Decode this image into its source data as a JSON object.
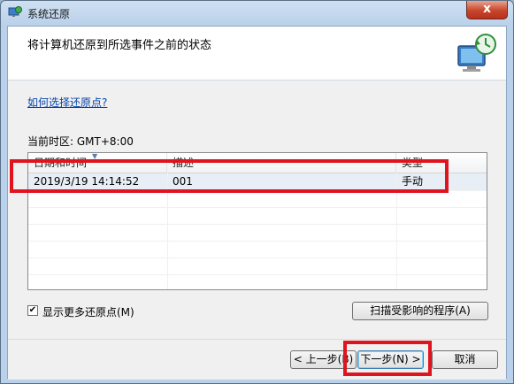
{
  "window": {
    "title": "系统还原",
    "close_symbol": "x"
  },
  "header": {
    "title": "将计算机还原到所选事件之前的状态",
    "graphic_icon": "system-restore-icon"
  },
  "main": {
    "help_link": "如何选择还原点?",
    "timezone": "当前时区: GMT+8:00",
    "table": {
      "columns": [
        "日期和时间",
        "描述",
        "类型"
      ],
      "rows": [
        {
          "datetime": "2019/3/19 14:14:52",
          "description": "001",
          "type": "手动"
        }
      ]
    },
    "show_more": {
      "label": "显示更多还原点(M)",
      "checked": true
    },
    "scan_button": "扫描受影响的程序(A)"
  },
  "footer": {
    "back_button": "< 上一步(B)",
    "next_button": "下一步(N) >",
    "cancel_button": "取消"
  },
  "annotations": {
    "highlight_color": "#e0141e"
  }
}
